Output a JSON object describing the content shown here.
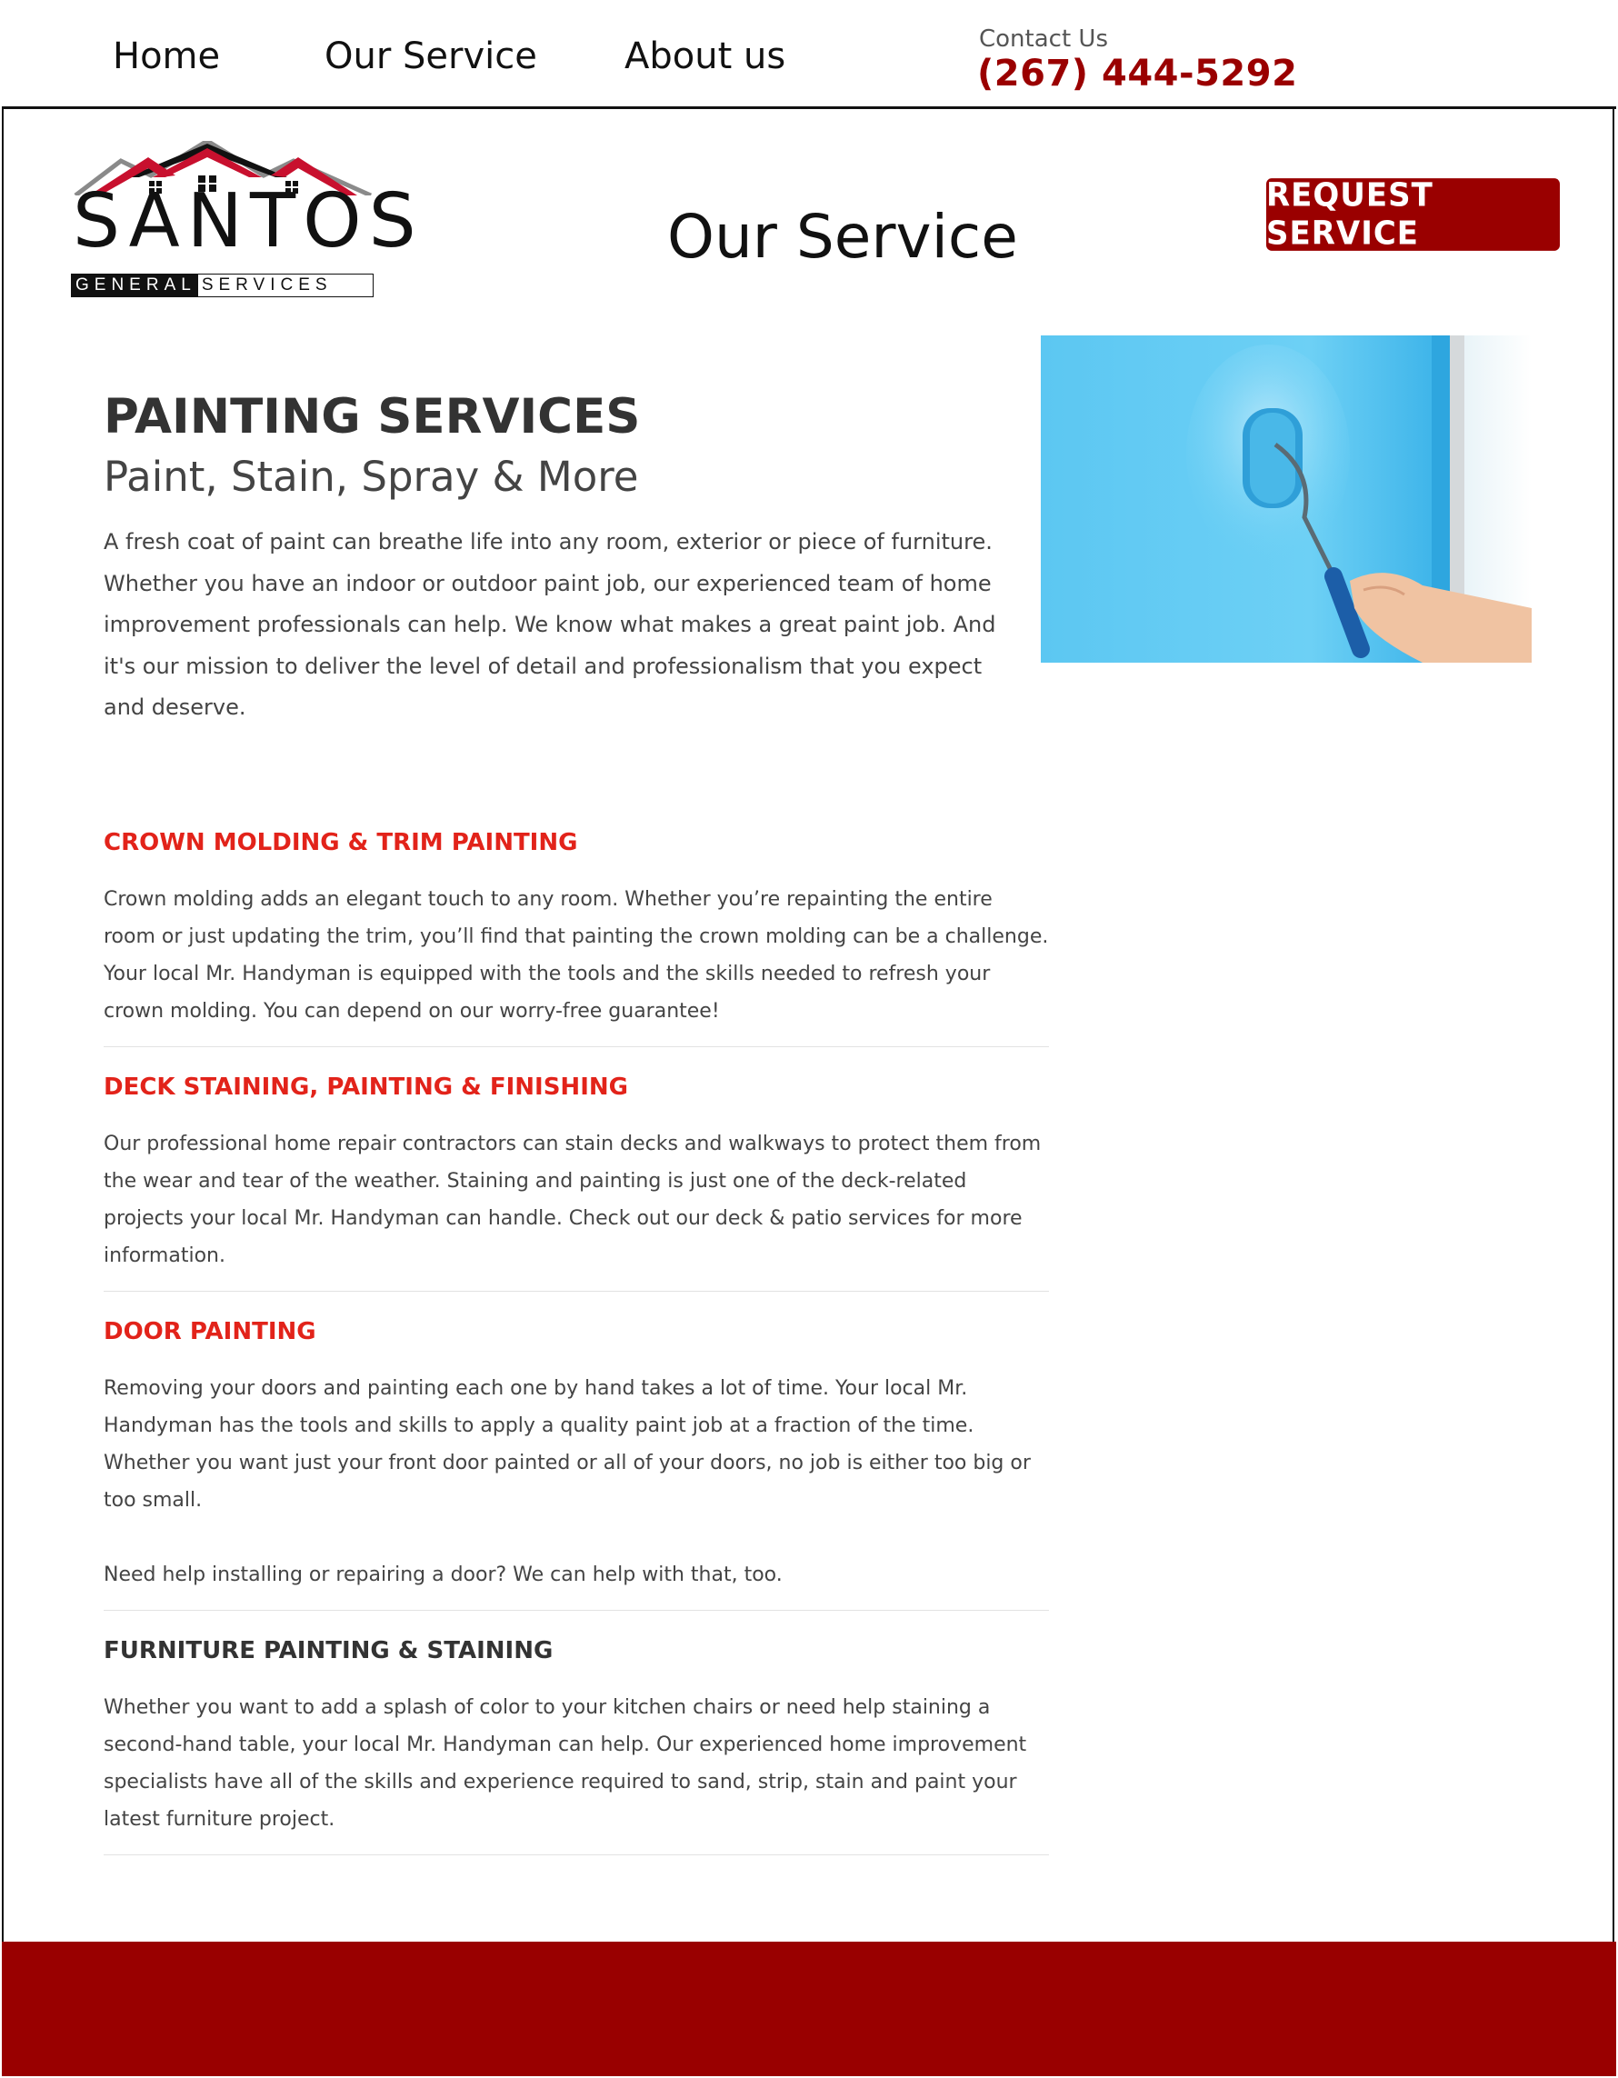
{
  "nav": {
    "home": "Home",
    "service": "Our Service",
    "about": "About us",
    "contact_label": "Contact Us",
    "contact_phone": "(267) 444-5292"
  },
  "logo": {
    "word": "SANTOS",
    "sub_dark": "GENERAL",
    "sub_light": "SERVICES"
  },
  "header": {
    "title": "Our Service",
    "request_button": "REQUEST SERVICE"
  },
  "hero": {
    "title": "PAINTING SERVICES",
    "subtitle": "Paint, Stain, Spray & More",
    "intro": "A fresh coat of paint can breathe life into any room, exterior or piece of furniture. Whether you have an indoor or outdoor paint job, our experienced team of home improvement professionals can help. We know what makes a great paint job. And it's our mission to deliver the level of detail and professionalism that you expect and deserve."
  },
  "services": [
    {
      "title": "CROWN MOLDING & TRIM PAINTING",
      "text": "Crown molding adds an elegant touch to any room. Whether you’re repainting the entire room or just updating the trim, you’ll find that painting the crown molding can be a challenge. Your local Mr. Handyman is equipped with the tools and the skills needed to refresh your crown molding. You can depend on our worry-free guarantee!"
    },
    {
      "title": "DECK STAINING, PAINTING & FINISHING",
      "text": "Our professional home repair contractors can stain decks and walkways to protect them from the wear and tear of the weather. Staining and painting is just one of the deck-related projects your local Mr. Handyman can handle. Check out our deck & patio services for more information."
    },
    {
      "title": "DOOR PAINTING",
      "text": "Removing your doors and painting each one by hand takes a lot of time. Your local Mr. Handyman has the tools and skills to apply a quality paint job at a fraction of the time. Whether you want just your front door painted or all of your doors, no job is either too big or too small.",
      "text2": "Need help installing or repairing a door? We can help with that, too."
    },
    {
      "title": "FURNITURE PAINTING & STAINING",
      "text": "Whether you want to add a splash of color to your kitchen chairs or need help staining a second-hand table, your local Mr. Handyman can help. Our experienced home improvement specialists have all of the skills and experience required to sand, strip, stain and paint your latest furniture project."
    }
  ],
  "colors": {
    "brand_red": "#9a0000",
    "accent_red": "#e2231a",
    "footer": "#990000"
  },
  "icons": {
    "logo": "house-roof-logo-icon",
    "hero_image": "paint-roller-image"
  }
}
